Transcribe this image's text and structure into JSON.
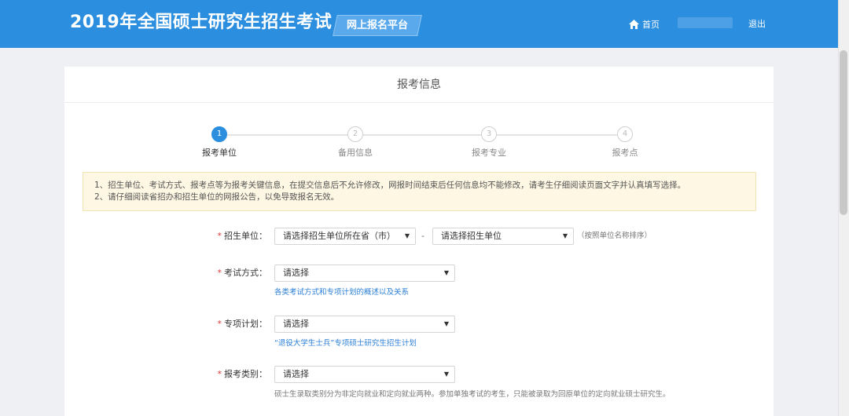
{
  "header": {
    "title": "2019年全国硕士研究生招生考试",
    "platform": "网上报名平台",
    "home": "首页",
    "logout": "退出"
  },
  "card": {
    "title": "报考信息"
  },
  "steps": [
    {
      "num": "1",
      "label": "报考单位",
      "active": true
    },
    {
      "num": "2",
      "label": "备用信息",
      "active": false
    },
    {
      "num": "3",
      "label": "报考专业",
      "active": false
    },
    {
      "num": "4",
      "label": "报考点",
      "active": false
    }
  ],
  "notice": {
    "line1": "1、招生单位、考试方式、报考点等为报考关键信息，在提交信息后不允许修改，网报时间结束后任何信息均不能修改，请考生仔细阅读页面文字并认真填写选择。",
    "line2": "2、请仔细阅读省招办和招生单位的网报公告，以免导致报名无效。"
  },
  "form": {
    "unit": {
      "label": "招生单位：",
      "province_value": "请选择招生单位所在省（市）",
      "dash": "-",
      "unit_value": "请选择招生单位",
      "hint": "（按照单位名称排序）"
    },
    "exam_mode": {
      "label": "考试方式：",
      "value": "请选择",
      "hint": "各类考试方式和专项计划的概述以及关系"
    },
    "special_plan": {
      "label": "专项计划：",
      "value": "请选择",
      "hint": "“退役大学生士兵”专项硕士研究生招生计划"
    },
    "category": {
      "label": "报考类别：",
      "value": "请选择",
      "hint": "硕士生录取类别分为非定向就业和定向就业两种。参加单独考试的考生，只能被录取为回原单位的定向就业硕士研究生。"
    }
  },
  "colors": {
    "header_bg": "#2b8ede",
    "accent": "#2b8ede",
    "required": "#e4393c",
    "notice_bg": "#fdf7e3",
    "link": "#2b7fd6"
  }
}
